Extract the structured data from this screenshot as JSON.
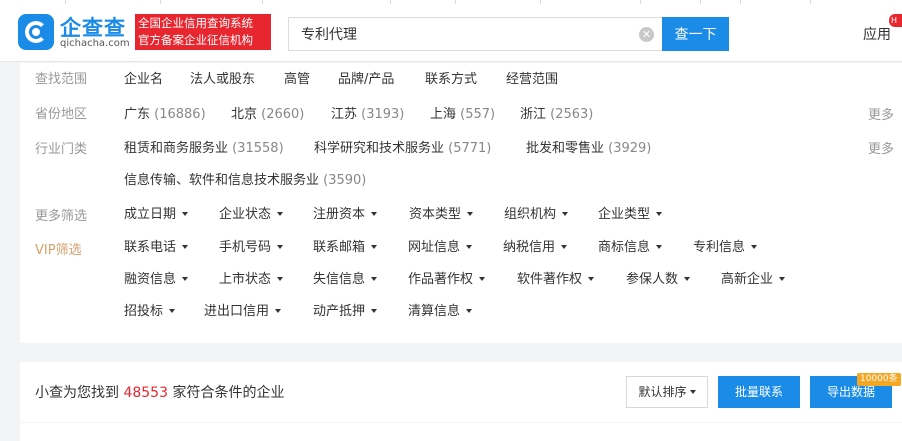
{
  "header": {
    "brand_name": "企查查",
    "brand_domain": "qichacha.com",
    "slogan_line1": "全国企业信用查询系统",
    "slogan_line2": "官方备案企业征信机构",
    "search_value": "专利代理",
    "search_button": "查一下",
    "app_link": "应用",
    "new_badge": "H"
  },
  "filters": {
    "scope": {
      "label": "查找范围",
      "options": [
        "企业名",
        "法人或股东",
        "高管",
        "品牌/产品",
        "联系方式",
        "经营范围"
      ]
    },
    "region": {
      "label": "省份地区",
      "options": [
        {
          "name": "广东",
          "count": "(16886)"
        },
        {
          "name": "北京",
          "count": "(2660)"
        },
        {
          "name": "江苏",
          "count": "(3193)"
        },
        {
          "name": "上海",
          "count": "(557)"
        },
        {
          "name": "浙江",
          "count": "(2563)"
        }
      ],
      "more": "更多"
    },
    "industry": {
      "label": "行业门类",
      "options": [
        {
          "name": "租赁和商务服务业",
          "count": "(31558)"
        },
        {
          "name": "科学研究和技术服务业",
          "count": "(5771)"
        },
        {
          "name": "批发和零售业",
          "count": "(3929)"
        },
        {
          "name": "信息传输、软件和信息技术服务业",
          "count": "(3590)"
        }
      ],
      "more": "更多"
    },
    "more_filters": {
      "label": "更多筛选",
      "options": [
        "成立日期",
        "企业状态",
        "注册资本",
        "资本类型",
        "组织机构",
        "企业类型"
      ]
    },
    "vip": {
      "label": "VIP筛选",
      "row1": [
        "联系电话",
        "手机号码",
        "联系邮箱",
        "网址信息",
        "纳税信用",
        "商标信息",
        "专利信息"
      ],
      "row2": [
        "融资信息",
        "上市状态",
        "失信信息",
        "作品著作权",
        "软件著作权",
        "参保人数",
        "高新企业"
      ],
      "row3": [
        "招投标",
        "进出口信用",
        "动产抵押",
        "清算信息"
      ]
    }
  },
  "result": {
    "prefix": "小查为您找到",
    "count": "48553",
    "suffix": "家符合条件的企业",
    "sort_label": "默认排序",
    "batch_contact": "批量联系",
    "export": "导出数据",
    "export_badge": "10000条"
  },
  "colors": {
    "brand_blue": "#1a8ce8",
    "red": "#e8262f",
    "vip_gold": "#d8a06a"
  }
}
